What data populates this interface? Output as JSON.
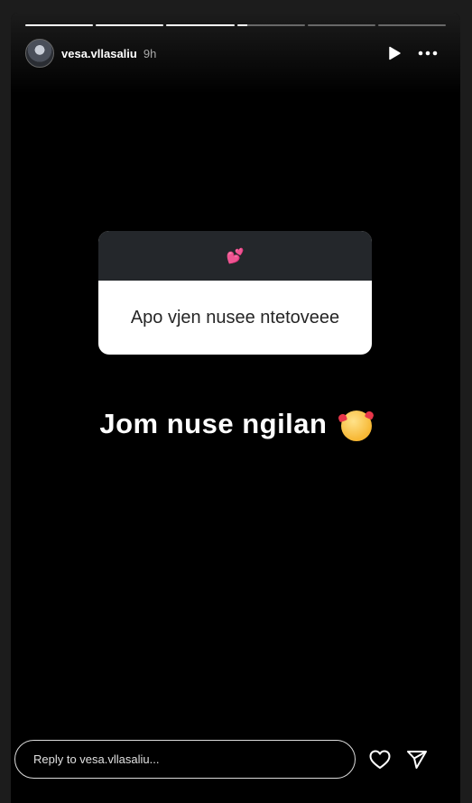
{
  "story": {
    "progress": [
      1,
      1,
      1,
      0.15,
      0,
      0,
      0
    ],
    "user": {
      "username": "vesa.vllasaliu",
      "time": "9h"
    },
    "question": {
      "emoji": "💕",
      "text": "Apo vjen nusee ntetoveee"
    },
    "answer": {
      "text": "Jom nuse ngilan",
      "emoji": "🥰"
    }
  },
  "reply": {
    "placeholder": "Reply to vesa.vllasaliu..."
  },
  "icons": {
    "play": "play-icon",
    "more": "more-icon",
    "heart": "heart-icon",
    "share": "send-icon"
  }
}
